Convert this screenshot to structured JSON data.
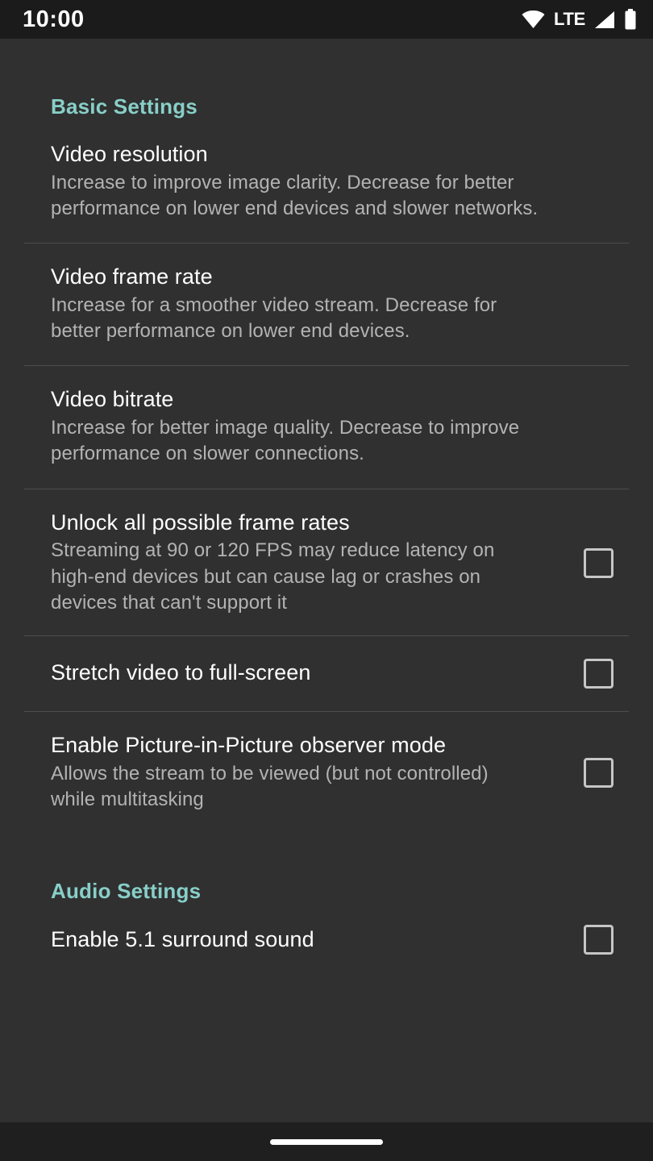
{
  "statusbar": {
    "time": "10:00",
    "network_label": "LTE",
    "icons": [
      "wifi-icon",
      "signal-icon",
      "battery-icon"
    ]
  },
  "colors": {
    "accent": "#88cfc8",
    "background": "#303030",
    "statusbar_background": "#1b1b1b",
    "navbar_background": "#1f1f1f",
    "title_text": "#ffffff",
    "summary_text": "#b3b3b3",
    "divider": "#4d4d4d",
    "checkbox_border": "#c6c6c6"
  },
  "sections": [
    {
      "id": "basic",
      "header": "Basic Settings",
      "items": [
        {
          "title": "Video resolution",
          "summary": "Increase to improve image clarity. Decrease for better performance on lower end devices and slower networks.",
          "has_checkbox": false
        },
        {
          "title": "Video frame rate",
          "summary": "Increase for a smoother video stream. Decrease for better performance on lower end devices.",
          "has_checkbox": false
        },
        {
          "title": "Video bitrate",
          "summary": "Increase for better image quality. Decrease to improve performance on slower connections.",
          "has_checkbox": false
        },
        {
          "title": "Unlock all possible frame rates",
          "summary": "Streaming at 90 or 120 FPS may reduce latency on high-end devices but can cause lag or crashes on devices that can't support it",
          "has_checkbox": true,
          "checked": false
        },
        {
          "title": "Stretch video to full-screen",
          "summary": "",
          "has_checkbox": true,
          "checked": false
        },
        {
          "title": "Enable Picture-in-Picture observer mode",
          "summary": "Allows the stream to be viewed (but not controlled) while multitasking",
          "has_checkbox": true,
          "checked": false
        }
      ]
    },
    {
      "id": "audio",
      "header": "Audio Settings",
      "items": [
        {
          "title": "Enable 5.1 surround sound",
          "summary": "",
          "has_checkbox": true,
          "checked": false
        }
      ]
    }
  ],
  "navbar": {
    "gesture_pill": "home-gesture-pill"
  }
}
